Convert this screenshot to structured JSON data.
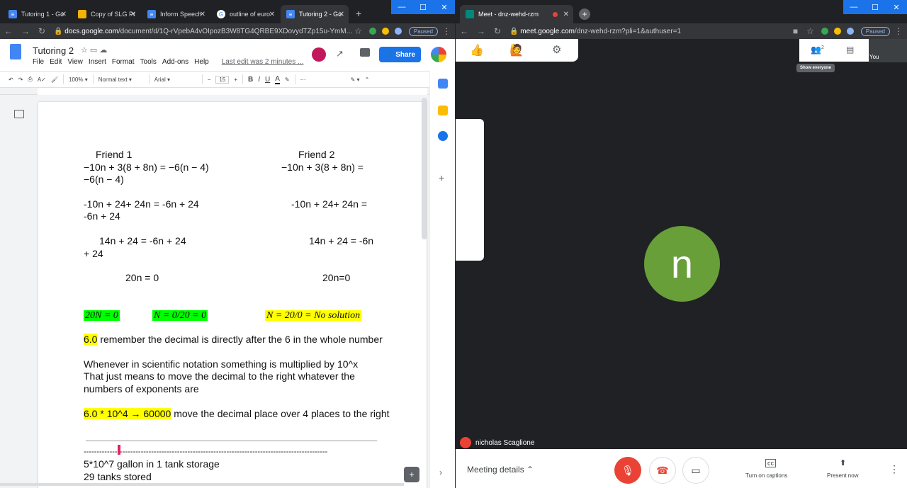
{
  "docs_window": {
    "tabs": [
      {
        "label": "Tutoring 1 - Go",
        "icon": "docs-icon"
      },
      {
        "label": "Copy of SLG Pr",
        "icon": "slides-icon"
      },
      {
        "label": "Inform Speech",
        "icon": "docs-icon"
      },
      {
        "label": "outline of euro",
        "icon": "google-icon"
      },
      {
        "label": "Tutoring 2 - Go",
        "icon": "docs-icon"
      }
    ],
    "url_domain": "docs.google.com",
    "url_path": "/document/d/1Q-rVpebA4vOIpozB3W8TG4QRBE9XDovydTZp15u-YmM...",
    "paused_label": "Paused",
    "doc_title": "Tutoring 2",
    "menu": [
      "File",
      "Edit",
      "View",
      "Insert",
      "Format",
      "Tools",
      "Add-ons",
      "Help"
    ],
    "last_edit": "Last edit was 2 minutes ...",
    "share_label": "Share",
    "toolbar": {
      "zoom": "100%",
      "style": "Normal text",
      "font": "Arial",
      "size": "15"
    },
    "content": {
      "friend1_heading": "Friend 1",
      "friend2_heading": "Friend 2",
      "f1_l1": "−10n + 3(8 + 8n) = −6(n − 4)",
      "f1_l2": "−6(n − 4)",
      "f2_l1": "−10n + 3(8 + 8n) =",
      "f1_l3": "-10n + 24+ 24n = -6n + 24",
      "f1_l4": "-6n + 24",
      "f2_l3": "-10n + 24+ 24n =",
      "f1_l5": "14n + 24 = -6n + 24",
      "f1_l6": "+ 24",
      "f2_l5": "14n + 24 = -6n",
      "f1_l7": "20n = 0",
      "f2_l7": "20n=0",
      "eq1": "20N = 0",
      "eq2": "N = 0/20 = 0",
      "eq3": "N = 20/0 = No solution",
      "p1_hl": "6.0",
      "p1_rest": " remember the decimal is directly after the 6 in the whole number",
      "p2_l1": "Whenever in scientific notation something is multiplied by 10^x",
      "p2_l2": "That just means to move the decimal to the right whatever the",
      "p2_l3": "numbers of exponents are",
      "p3_hl": "6.0 * 10^4 → 60000",
      "p3_rest": " move the decimal place over 4 places to the right",
      "dashes": "----------------------------------------------------------------------------------------------",
      "p4_l1": "5*10^7 gallon in 1 tank storage",
      "p4_l2": "29 tanks stored"
    }
  },
  "meet_window": {
    "tab_label": "Meet - dnz-wehd-rzm",
    "url_domain": "meet.google.com",
    "url_path": "/dnz-wehd-rzm?pli=1&authuser=1",
    "paused_label": "Paused",
    "people_count": "2",
    "tooltip": "Show everyone",
    "self_label": "You",
    "avatar_letter": "n",
    "participant_name": "nicholas Scaglione",
    "meeting_details": "Meeting details",
    "captions_label": "Turn on captions",
    "present_label": "Present now"
  },
  "colors": {
    "docs_blue": "#1a73e8",
    "avatar_green": "#689f38",
    "mic_red": "#ea4335",
    "highlight_green": "#00ff00",
    "highlight_yellow": "#ffff00"
  }
}
